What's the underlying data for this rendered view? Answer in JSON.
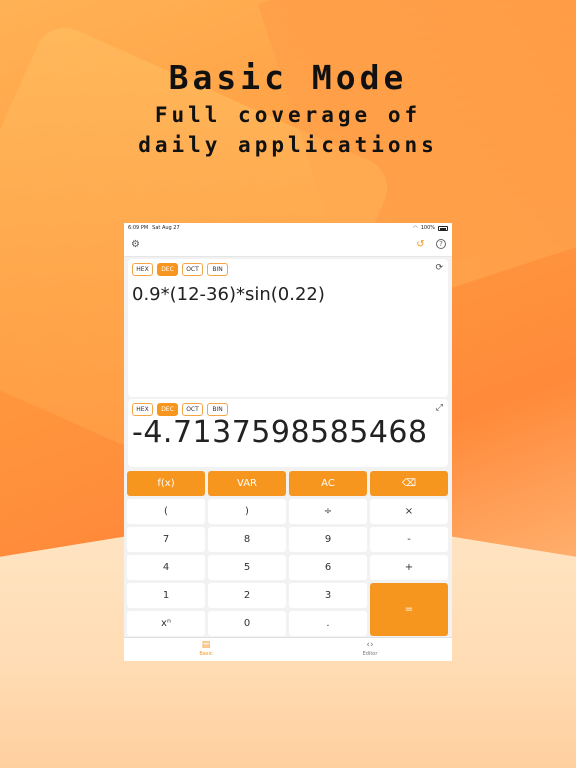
{
  "promo": {
    "title": "Basic Mode",
    "subtitle_line1": "Full coverage of",
    "subtitle_line2": "daily applications"
  },
  "status_bar": {
    "time": "6:09 PM",
    "date": "Sat Aug 27",
    "battery": "100%"
  },
  "toolbar": {
    "settings_icon": "gear-icon",
    "history_icon": "history-icon",
    "help_icon": "question-icon"
  },
  "input_panel": {
    "modes": [
      "HEX",
      "DEC",
      "OCT",
      "BIN"
    ],
    "active_mode": "DEC",
    "expression": "0.9*(12-36)*sin(0.22)",
    "icon": "swap-icon"
  },
  "output_panel": {
    "modes": [
      "HEX",
      "DEC",
      "OCT",
      "BIN"
    ],
    "active_mode": "DEC",
    "result": "-4.7137598585468",
    "icon": "expand-icon"
  },
  "keypad": {
    "keys": [
      "f(x)",
      "VAR",
      "AC",
      "⌫",
      "(",
      ")",
      "÷",
      "×",
      "7",
      "8",
      "9",
      "-",
      "4",
      "5",
      "6",
      "+",
      "1",
      "2",
      "3",
      "=",
      "xⁿ",
      "0",
      "."
    ]
  },
  "tabbar": {
    "basic_label": "Basic",
    "editor_label": "Editor"
  },
  "colors": {
    "accent": "#f7961f",
    "background": "#ff9a3e"
  }
}
